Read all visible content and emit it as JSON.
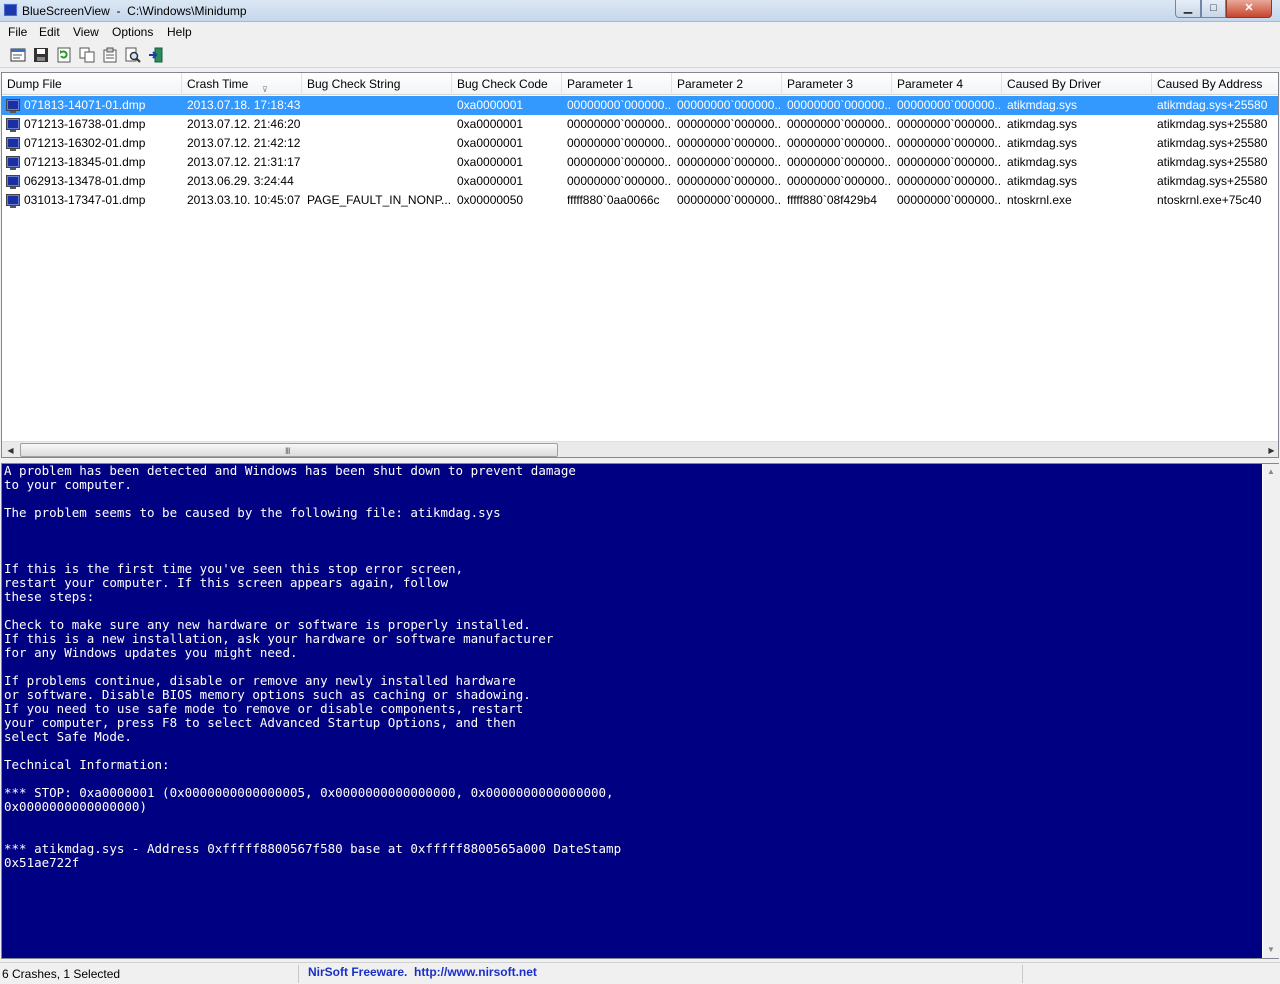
{
  "window": {
    "title": "BlueScreenView  -  C:\\Windows\\Minidump",
    "controls": {
      "minimize": "▁",
      "maximize": "□",
      "close": "✕"
    }
  },
  "menu": [
    "File",
    "Edit",
    "View",
    "Options",
    "Help"
  ],
  "toolbar": {
    "buttons": [
      "properties-icon",
      "save-icon",
      "refresh-icon",
      "copy-icon",
      "html-report-icon",
      "find-icon",
      "exit-icon"
    ]
  },
  "list": {
    "columns": [
      "Dump File",
      "Crash Time",
      "Bug Check String",
      "Bug Check Code",
      "Parameter 1",
      "Parameter 2",
      "Parameter 3",
      "Parameter 4",
      "Caused By Driver",
      "Caused By Address"
    ],
    "sort_indicator": "⊽",
    "rows": [
      [
        "071813-14071-01.dmp",
        "2013.07.18. 17:18:43",
        "",
        "0xa0000001",
        "00000000`000000...",
        "00000000`000000...",
        "00000000`000000...",
        "00000000`000000...",
        "atikmdag.sys",
        "atikmdag.sys+25580"
      ],
      [
        "071213-16738-01.dmp",
        "2013.07.12. 21:46:20",
        "",
        "0xa0000001",
        "00000000`000000...",
        "00000000`000000...",
        "00000000`000000...",
        "00000000`000000...",
        "atikmdag.sys",
        "atikmdag.sys+25580"
      ],
      [
        "071213-16302-01.dmp",
        "2013.07.12. 21:42:12",
        "",
        "0xa0000001",
        "00000000`000000...",
        "00000000`000000...",
        "00000000`000000...",
        "00000000`000000...",
        "atikmdag.sys",
        "atikmdag.sys+25580"
      ],
      [
        "071213-18345-01.dmp",
        "2013.07.12. 21:31:17",
        "",
        "0xa0000001",
        "00000000`000000...",
        "00000000`000000...",
        "00000000`000000...",
        "00000000`000000...",
        "atikmdag.sys",
        "atikmdag.sys+25580"
      ],
      [
        "062913-13478-01.dmp",
        "2013.06.29. 3:24:44",
        "",
        "0xa0000001",
        "00000000`000000...",
        "00000000`000000...",
        "00000000`000000...",
        "00000000`000000...",
        "atikmdag.sys",
        "atikmdag.sys+25580"
      ],
      [
        "031013-17347-01.dmp",
        "2013.03.10. 10:45:07",
        "PAGE_FAULT_IN_NONP...",
        "0x00000050",
        "fffff880`0aa0066c",
        "00000000`000000...",
        "fffff880`08f429b4",
        "00000000`000000...",
        "ntoskrnl.exe",
        "ntoskrnl.exe+75c40"
      ]
    ],
    "selected_row": 0,
    "hscroll_grip": "III"
  },
  "bsod": {
    "lines": [
      "A problem has been detected and Windows has been shut down to prevent damage",
      "to your computer.",
      "",
      "The problem seems to be caused by the following file: atikmdag.sys",
      "",
      "",
      "",
      "If this is the first time you've seen this stop error screen,",
      "restart your computer. If this screen appears again, follow",
      "these steps:",
      "",
      "Check to make sure any new hardware or software is properly installed.",
      "If this is a new installation, ask your hardware or software manufacturer",
      "for any Windows updates you might need.",
      "",
      "If problems continue, disable or remove any newly installed hardware",
      "or software. Disable BIOS memory options such as caching or shadowing.",
      "If you need to use safe mode to remove or disable components, restart",
      "your computer, press F8 to select Advanced Startup Options, and then",
      "select Safe Mode.",
      "",
      "Technical Information:",
      "",
      "*** STOP: 0xa0000001 (0x0000000000000005, 0x0000000000000000, 0x0000000000000000,",
      "0x0000000000000000)",
      "",
      "",
      "*** atikmdag.sys - Address 0xfffff8800567f580 base at 0xfffff8800565a000 DateStamp",
      "0x51ae722f"
    ]
  },
  "status": {
    "summary": "6 Crashes, 1 Selected",
    "credit": "NirSoft Freeware.  http://www.nirsoft.net"
  },
  "colors": {
    "bsod_background": "#000082",
    "selection": "#3399ff",
    "link": "#1a2fc8"
  }
}
